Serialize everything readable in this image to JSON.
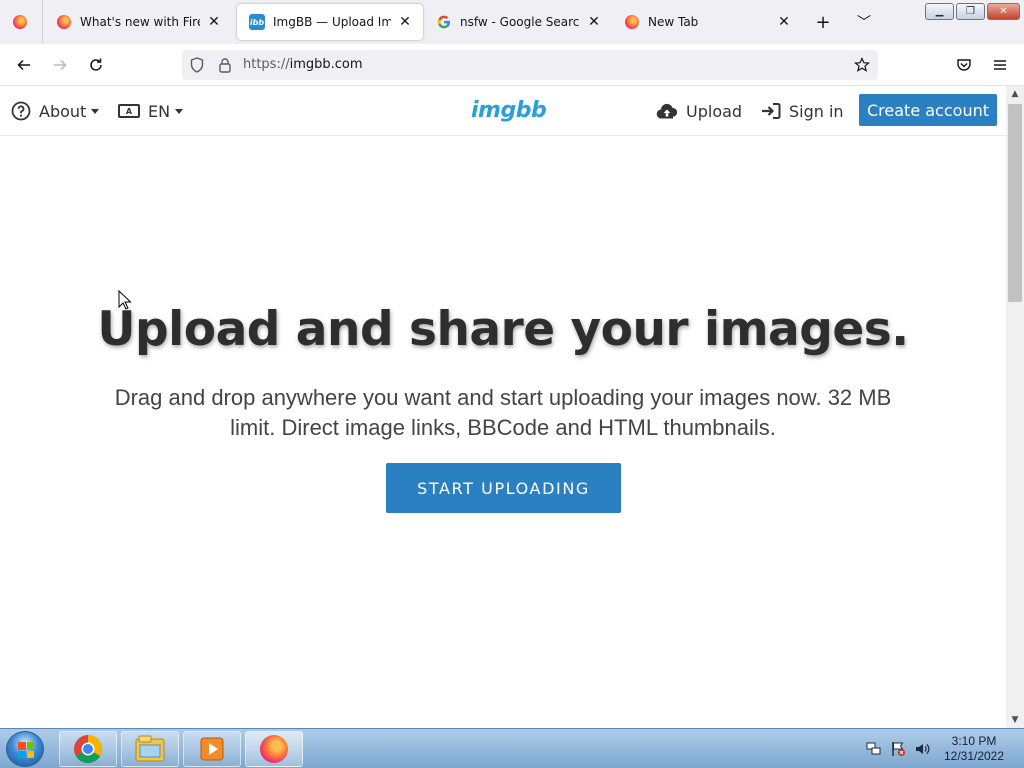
{
  "browser": {
    "tabs": [
      {
        "title": "What's new with Firefox -",
        "favicon": "firefox-icon",
        "active": false
      },
      {
        "title": "ImgBB — Upload Image -",
        "favicon": "imgbb-icon",
        "active": true
      },
      {
        "title": "nsfw - Google Search",
        "favicon": "google-icon",
        "active": false
      },
      {
        "title": "New Tab",
        "favicon": "firefox-icon",
        "active": false
      }
    ],
    "url_scheme": "https://",
    "url_host": "imgbb.com"
  },
  "site": {
    "nav": {
      "about_label": "About",
      "lang_label": "EN",
      "lang_icon_text": "A",
      "logo_text": "imgbb",
      "upload_label": "Upload",
      "signin_label": "Sign in",
      "create_account_label": "Create account"
    },
    "hero": {
      "title": "Upload and share your images.",
      "subtitle": "Drag and drop anywhere you want and start uploading your images now. 32 MB limit. Direct image links, BBCode and HTML thumbnails.",
      "cta_label": "START UPLOADING"
    },
    "colors": {
      "accent": "#2a80c1",
      "logo": "#2a9fd8"
    }
  },
  "taskbar": {
    "pinned": [
      "chrome-icon",
      "explorer-icon",
      "media-player-icon",
      "firefox-icon"
    ],
    "clock_time": "3:10 PM",
    "clock_date": "12/31/2022"
  }
}
